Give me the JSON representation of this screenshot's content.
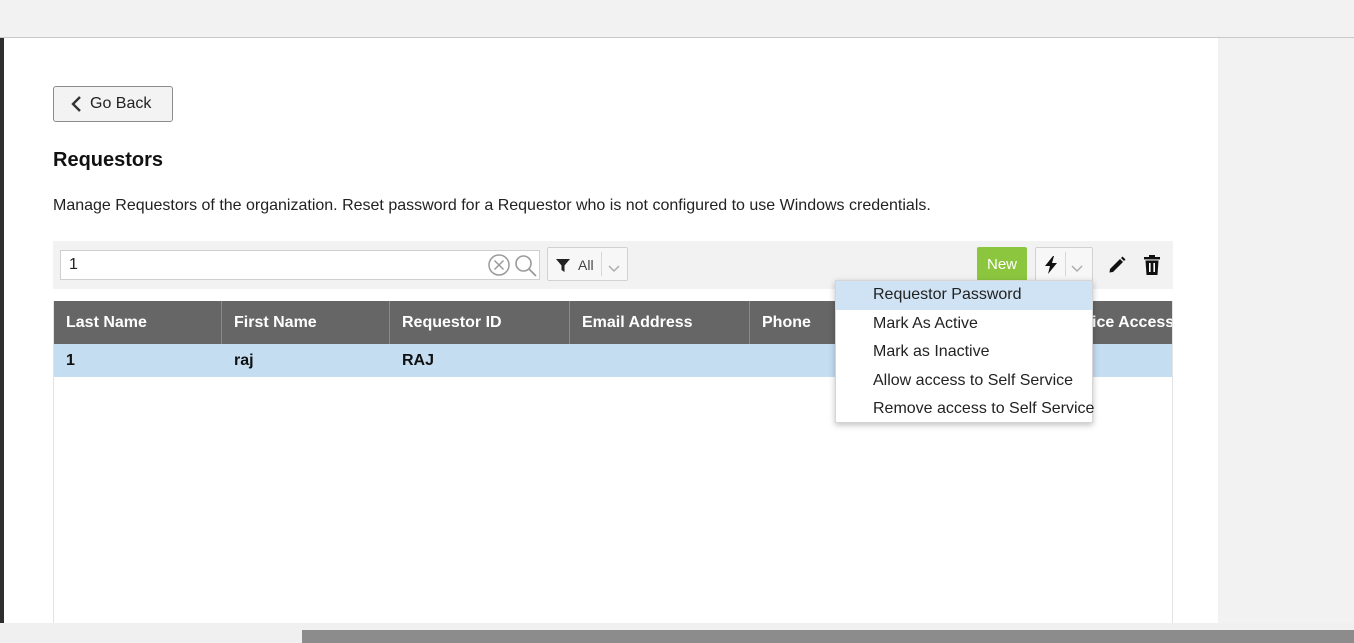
{
  "header": {
    "back_label": "Go Back",
    "title": "Requestors",
    "description": "Manage Requestors of the organization. Reset password for a Requestor who is not configured to use Windows credentials."
  },
  "toolbar": {
    "search_value": "1",
    "filter_label": "All",
    "new_label": "New"
  },
  "table": {
    "columns": [
      "Last Name",
      "First Name",
      "Requestor ID",
      "Email Address",
      "Phone",
      "ice Access"
    ],
    "rows": [
      {
        "last_name": "1",
        "first_name": "raj",
        "requestor_id": "RAJ",
        "email": "",
        "phone": ""
      }
    ]
  },
  "actions_menu": {
    "items": [
      "Requestor Password",
      "Mark As Active",
      "Mark as Inactive",
      "Allow access to Self Service",
      "Remove access to Self Service"
    ],
    "highlighted_index": 0
  },
  "colors": {
    "header_bg": "#666666",
    "selected_row": "#c5ddf1",
    "new_button": "#8cc63f",
    "menu_highlight": "#cfe3f5"
  },
  "icons": [
    "chevron-left-icon",
    "clear-icon",
    "search-icon",
    "filter-icon",
    "chevron-down-icon",
    "bolt-icon",
    "edit-icon",
    "delete-icon"
  ]
}
